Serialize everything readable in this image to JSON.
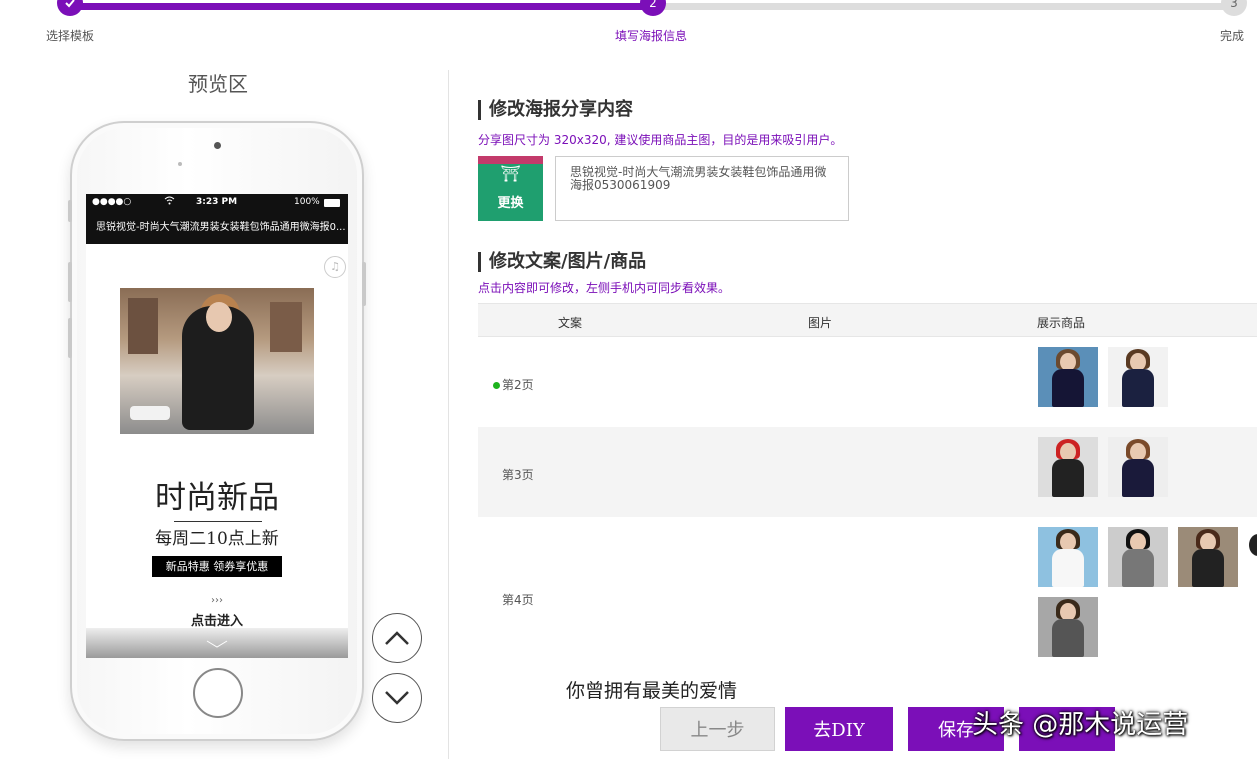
{
  "steps": [
    {
      "number": "",
      "label": "选择模板",
      "state": "done"
    },
    {
      "number": "2",
      "label": "填写海报信息",
      "state": "active"
    },
    {
      "number": "3",
      "label": "完成",
      "state": "todo"
    }
  ],
  "preview": {
    "title": "预览区",
    "status_bar": {
      "signal": "●●●●○",
      "wifi": "wifi",
      "time": "3:23 PM",
      "battery": "100%"
    },
    "nav_title": "思锐视觉-时尚大气潮流男装女装鞋包饰品通用微海报0...",
    "headline": "时尚新品",
    "subline": "每周二10点上新",
    "tag": "新品特惠 领券享优惠",
    "arrows": "›››",
    "enter": "点击进入"
  },
  "section1": {
    "title": "修改海报分享内容",
    "hint": "分享图尺寸为 320x320, 建议使用商品主图，目的是用来吸引用户。",
    "change_label": "更换",
    "share_text": "思锐视觉-时尚大气潮流男装女装鞋包饰品通用微海报0530061909"
  },
  "section2": {
    "title": "修改文案/图片/商品",
    "hint": "点击内容即可修改，左侧手机内可同步看效果。",
    "columns": [
      "文案",
      "图片",
      "展示商品"
    ],
    "rows": [
      {
        "label": "第2页",
        "active": true
      },
      {
        "label": "第3页",
        "active": false
      },
      {
        "label": "第4页",
        "active": false
      }
    ]
  },
  "buttons": {
    "prev": "上一步",
    "diy": "去DIY",
    "save": "保存"
  },
  "overlay": {
    "subtitle": "你曾拥有最美的爱情",
    "watermark": "头条 @那木说运营"
  },
  "colors": {
    "accent": "#7b0fb8",
    "active_dot": "#1db31d"
  }
}
